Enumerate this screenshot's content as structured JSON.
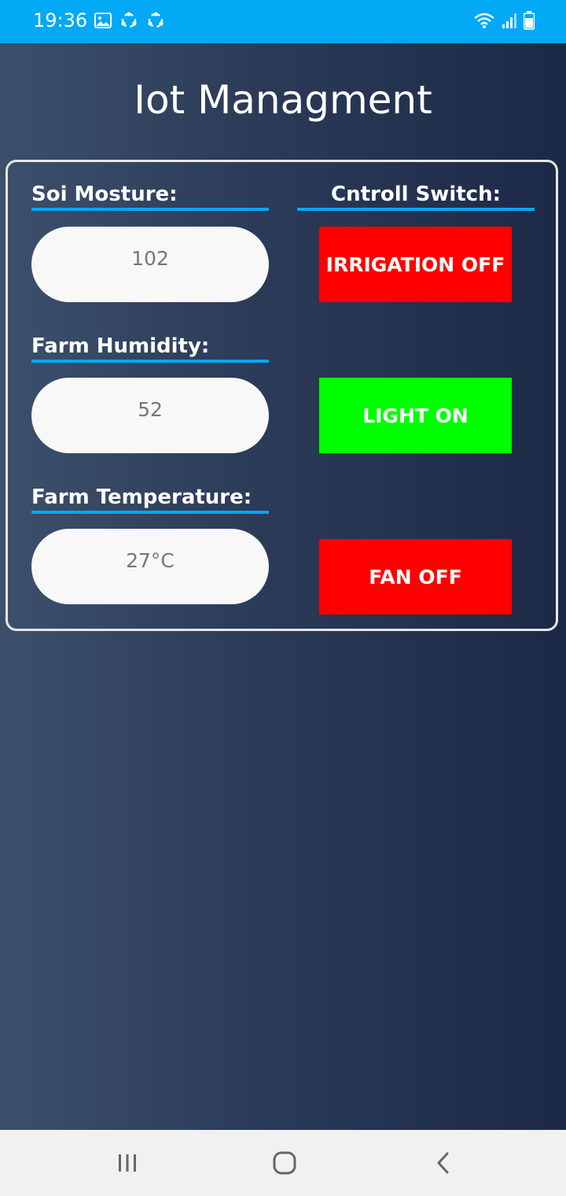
{
  "status_bar": {
    "time": "19:36",
    "background": "#03a9f4",
    "icons_left": [
      "gallery-icon",
      "sync-icon",
      "sync-icon"
    ],
    "icons_right": [
      "wifi-icon",
      "signal-icon",
      "battery-icon"
    ]
  },
  "app": {
    "title": "Iot Managment"
  },
  "sensors": [
    {
      "label": "Soi Mosture:",
      "value": "102"
    },
    {
      "label": "Farm Humidity:",
      "value": "52"
    },
    {
      "label": "Farm Temperature:",
      "value": "27°C"
    }
  ],
  "controls": {
    "label": "Cntroll Switch:",
    "switches": [
      {
        "text": "IRRIGATION OFF",
        "color": "#ff0000"
      },
      {
        "text": "LIGHT ON",
        "color": "#00ff00"
      },
      {
        "text": "FAN OFF",
        "color": "#ff0000"
      }
    ]
  },
  "nav_bar": {
    "buttons": [
      "recent-apps-icon",
      "home-icon",
      "back-icon"
    ]
  }
}
